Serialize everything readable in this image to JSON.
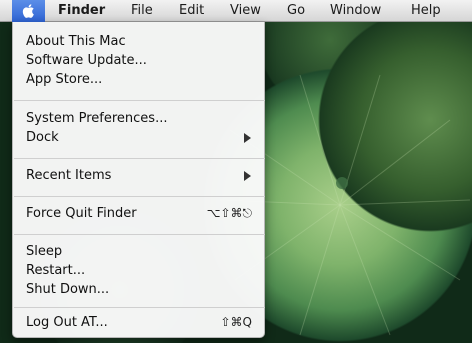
{
  "menubar": {
    "apple_icon": "apple-logo-icon",
    "items": [
      "Finder",
      "File",
      "Edit",
      "View",
      "Go",
      "Window",
      "Help"
    ],
    "accent_color": "#3a72dc"
  },
  "apple_menu": {
    "items": [
      {
        "label": "About This Mac"
      },
      {
        "label": "Software Update..."
      },
      {
        "label": "App Store..."
      },
      {
        "label": "System Preferences..."
      },
      {
        "label": "Dock",
        "submenu": true
      },
      {
        "label": "Recent Items",
        "submenu": true
      },
      {
        "label": "Force Quit Finder",
        "shortcut": "⌥⇧⌘⎋"
      },
      {
        "label": "Sleep"
      },
      {
        "label": "Restart..."
      },
      {
        "label": "Shut Down..."
      },
      {
        "label": "Log Out AT...",
        "shortcut": "⇧⌘Q"
      }
    ]
  }
}
